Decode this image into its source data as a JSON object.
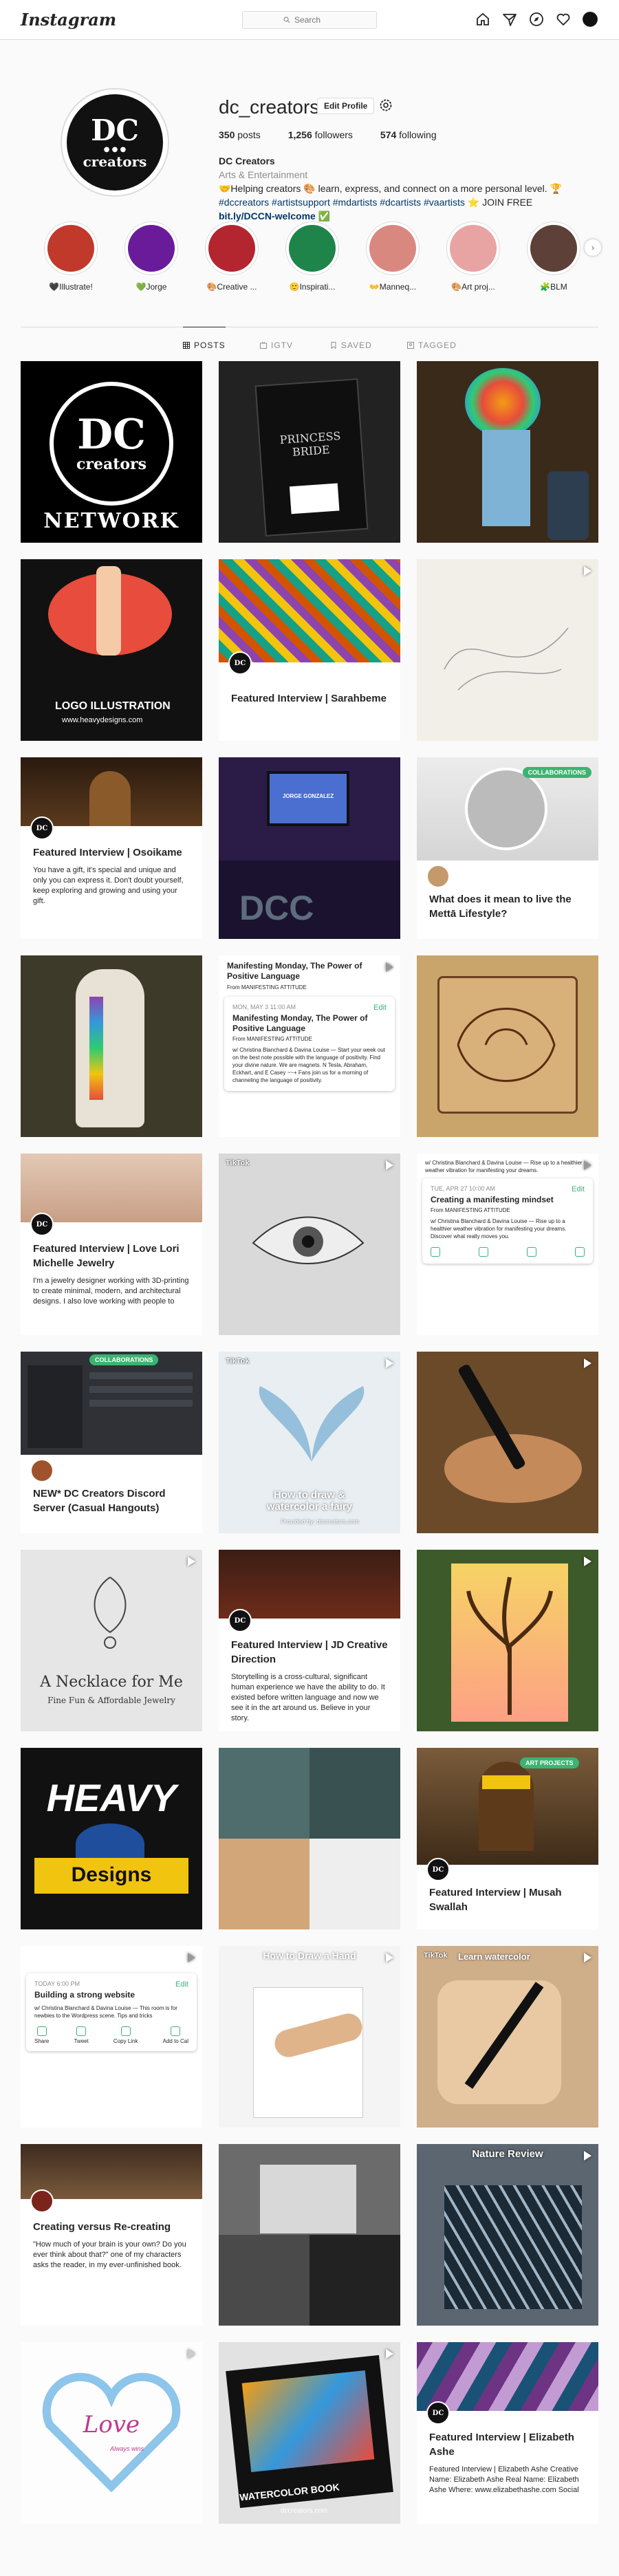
{
  "nav": {
    "logo": "Instagram",
    "search_placeholder": "Search"
  },
  "profile": {
    "username": "dc_creators",
    "edit_label": "Edit Profile",
    "posts_count": "350",
    "posts_label": "posts",
    "followers_count": "1,256",
    "followers_label": "followers",
    "following_count": "574",
    "following_label": "following",
    "name": "DC Creators",
    "category": "Arts & Entertainment",
    "bio_line1": "🤝Helping creators 🎨 learn, express, and connect on a more personal level. 🏆",
    "bio_tags": "#dccreators #artistsupport #mdartists #dcartists #vaartists",
    "bio_join": "⭐ JOIN FREE",
    "bio_link": "bit.ly/DCCN-welcome ✅",
    "avatar_top": "DC",
    "avatar_bottom": "creators"
  },
  "highlights": [
    {
      "label": "🖤Illustrate!",
      "color": "#c0392b"
    },
    {
      "label": "💚Jorge",
      "color": "#6a1b9a"
    },
    {
      "label": "🎨Creative ...",
      "color": "#b3262f"
    },
    {
      "label": "🙂Inspirati...",
      "color": "#1e8449"
    },
    {
      "label": "👐Manneq...",
      "color": "#d98880"
    },
    {
      "label": "🎨Art proj...",
      "color": "#e8a3a3"
    },
    {
      "label": "🧩BLM",
      "color": "#5d4037"
    }
  ],
  "tabs": {
    "posts": "POSTS",
    "igtv": "IGTV",
    "saved": "SAVED",
    "tagged": "TAGGED"
  },
  "posts": {
    "p1": {
      "top": "DC",
      "middle": "creators",
      "bottom": "NETWORK"
    },
    "p2": {
      "line1": "PRINCESS",
      "line2": "BRIDE"
    },
    "p4": {
      "caption": "LOGO ILLUSTRATION",
      "url": "www.heavydesigns.com"
    },
    "p5": {
      "title": "Featured Interview | Sarahbeme"
    },
    "p7": {
      "title": "Featured Interview | Osoikame",
      "body": "You have a gift, it's special and unique and only you can express it. Don't doubt yourself, keep exploring and growing and using your gift."
    },
    "p8": {
      "tv": "JORGE GONZALEZ",
      "floor": "DCC"
    },
    "p9": {
      "badge": "COLLABORATIONS",
      "title": "What does it mean to live the Mettā Lifestyle?"
    },
    "p11": {
      "header": "Manifesting Monday, The Power of Positive Language",
      "from": "From MANIFESTING ATTITUDE",
      "date": "MON, MAY 3 11:00 AM",
      "edit": "Edit",
      "title": "Manifesting Monday, The Power of Positive Language",
      "cfrom": "From MANIFESTING ATTITUDE",
      "body": "w/ Christina Blanchard & Davina Louise — Start your week out on the best note possible with the language of positivity. Find your divine nature. We are magnets. N Tesla, Abraham, Eckhart, and E Casey ~~+ Fans join us for a morning of channeling the language of positivity."
    },
    "p13": {
      "title": "Featured Interview | Love Lori Michelle Jewelry",
      "body": "I'm a jewelry designer working with 3D-printing to create minimal, modern, and architectural designs. I also love working with people to"
    },
    "p14": {
      "tiktok": "TikTok"
    },
    "p15": {
      "top": "w/ Christina Blanchard & Davina Louise — Rise up to a healthier weather vibration for manifesting your dreams.",
      "date": "TUE, APR 27 10:00 AM",
      "edit": "Edit",
      "title": "Creating a manifesting mindset",
      "from": "From MANIFESTING ATTITUDE",
      "body": "w/ Christina Blanchard & Davina Louise — Rise up to a healthier weather vibration for manifesting your dreams. Discover what really moves you."
    },
    "p16": {
      "badge": "COLLABORATIONS",
      "title": "NEW* DC Creators Discord Server (Casual Hangouts)"
    },
    "p17": {
      "tiktok": "TikTok",
      "caption": "How to draw & watercolor a fairy",
      "by": "Provided by: dccreators.com"
    },
    "p19": {
      "title": "A Necklace for Me",
      "sub": "Fine Fun & Affordable Jewelry"
    },
    "p20": {
      "title": "Featured Interview | JD Creative Direction",
      "body": "Storytelling is a cross-cultural, significant human experience we have the ability to do. It existed before written language and now we see it in the art around us. Believe in your story."
    },
    "p22": {
      "top": "HEAVY",
      "bottom": "Designs"
    },
    "p24": {
      "badge": "ART PROJECTS",
      "title": "Featured Interview | Musah Swallah"
    },
    "p25": {
      "date": "TODAY 6:00 PM",
      "edit": "Edit",
      "title": "Building a strong website",
      "body": "w/ Christina Blanchard & Davina Louise — This room is for newbies to the Wordpress scene. Tips and tricks",
      "share": "Share",
      "tweet": "Tweet",
      "copy": "Copy Link",
      "cal": "Add to Cal"
    },
    "p26": {
      "caption": "How to Draw a Hand"
    },
    "p27": {
      "tiktok": "TikTok",
      "caption": "Learn watercolor"
    },
    "p28": {
      "title": "Creating versus Re-creating",
      "body": "\"How much of your brain is your own? Do you ever think about that?\" one of my characters asks the reader, in my ever-unfinished book."
    },
    "p30": {
      "caption": "Nature Review"
    },
    "p31": {
      "word": "Love",
      "small": "Always wins"
    },
    "p32": {
      "caption": "WATERCOLOR BOOK",
      "url": "dccreators.com"
    },
    "p33": {
      "title": "Featured Interview | Elizabeth Ashe",
      "body": "Featured Interview | Elizabeth Ashe Creative Name: Elizabeth Ashe Real Name: Elizabeth Ashe Where: www.elizabethashe.com Social"
    }
  }
}
